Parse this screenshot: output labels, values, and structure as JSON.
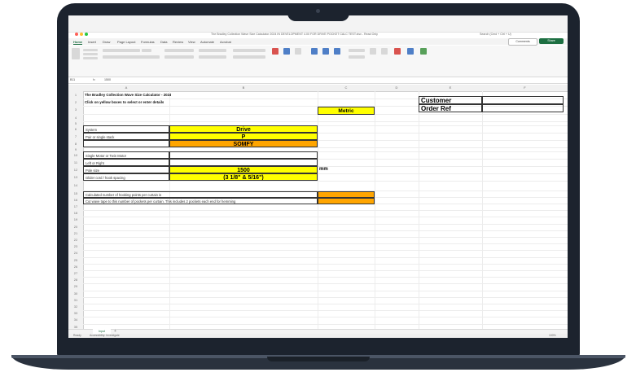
{
  "window": {
    "title": "The Bradley Collection Wave Size Calculator 2024 IN DEVELOPMENT 4.00 FOR DRIVE POCKET CALC TEST.xlsx - Read Only",
    "search_placeholder": "Search (Cmd + Ctrl + U)"
  },
  "menu": [
    "Home",
    "Insert",
    "Draw",
    "Page Layout",
    "Formulas",
    "Data",
    "Review",
    "View",
    "Automate",
    "Acrobat"
  ],
  "buttons": {
    "comments": "Comments",
    "share": "Share"
  },
  "formula_bar": {
    "name_box": "B11",
    "fx": "fx",
    "value": "1500"
  },
  "columns": [
    "A",
    "B",
    "C",
    "D",
    "E",
    "F"
  ],
  "rows": [
    "1",
    "2",
    "3",
    "4",
    "5",
    "6",
    "7",
    "8",
    "9",
    "10",
    "11",
    "12",
    "13",
    "14",
    "15",
    "16",
    "17",
    "18",
    "19",
    "20",
    "21",
    "22",
    "23",
    "24",
    "25",
    "26",
    "27",
    "28",
    "29",
    "30",
    "31",
    "32",
    "33",
    "34",
    "35",
    "36",
    "37",
    "38",
    "39"
  ],
  "sheet": {
    "title": "The Bradley Collection Wave Size Calculator - 2024",
    "instruction": "Click on yellow boxes to select or enter details",
    "metric": "Metric",
    "customer_label": "Customer",
    "order_label": "Order Ref",
    "labels": {
      "system": "System",
      "pair": "Pair or single stack",
      "motor": "Single Motor or Twin Motor",
      "left_right": "Left or Right",
      "pole": "Pole size",
      "glider": "Glider cord / hook spacing"
    },
    "values": {
      "system": "Drive",
      "pair": "P",
      "brand": "SOMFY",
      "pole": "1500",
      "glider": "(3 1/8\" & 5/16\")"
    },
    "unit": "mm",
    "calc1": "Calculated number of hooking points per curtain is",
    "calc2": "Cut wave tape to this number of pockets per curtain. This includes 2 pockets each end for hemming"
  },
  "tabs": {
    "active": "Input"
  },
  "status": {
    "left": "Ready",
    "accessibility": "Accessibility: Investigate",
    "zoom": "100%"
  }
}
